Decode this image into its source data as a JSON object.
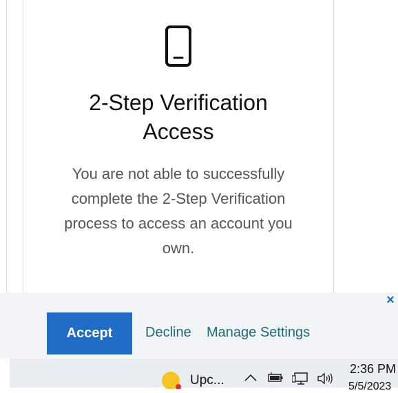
{
  "card": {
    "icon": "mobile-phone-icon",
    "title_line1": "2-Step Verification",
    "title_line2": "Access",
    "description": "You are not able to successfully complete the 2-Step Verification process to access an account you own."
  },
  "consent": {
    "close_icon": "close-icon",
    "close_symbol": "×",
    "accept_label": "Accept",
    "decline_label": "Decline",
    "manage_label": "Manage Settings"
  },
  "taskbar": {
    "app_label": "Upc...",
    "tray_icons": [
      "chevron-up-icon",
      "battery-icon",
      "network-icon",
      "volume-icon"
    ],
    "time": "2:36 PM",
    "date": "5/5/2023"
  },
  "colors": {
    "accent": "#1f6dc6",
    "link": "#1d6a7a",
    "close": "#1a6fd0",
    "consent_bg": "#f2f4f7",
    "taskbar_bg": "#e9ecf0"
  }
}
